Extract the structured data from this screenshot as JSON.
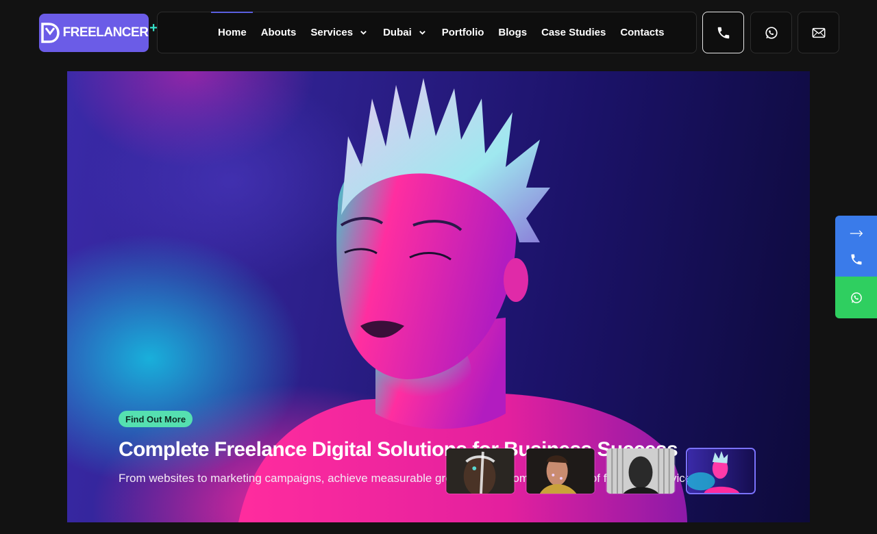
{
  "logo": {
    "text": "FREELANCER",
    "plus": "+",
    "colors": {
      "bg": "#6b5ce7",
      "accent": "#35e0c8"
    }
  },
  "nav": {
    "items": [
      {
        "label": "Home",
        "active": true
      },
      {
        "label": "Abouts"
      },
      {
        "label": "Services",
        "dropdown": true
      },
      {
        "label": "Dubai",
        "dropdown": true
      },
      {
        "label": "Portfolio"
      },
      {
        "label": "Blogs"
      },
      {
        "label": "Case Studies"
      },
      {
        "label": "Contacts"
      }
    ],
    "active_color": "#5b5fe0"
  },
  "header_actions": [
    {
      "icon": "phone-icon"
    },
    {
      "icon": "whatsapp-icon"
    },
    {
      "icon": "mail-icon"
    }
  ],
  "hero": {
    "badge": "Find Out More",
    "title": "Complete Freelance Digital Solutions for Business Success",
    "subtitle": "From websites to marketing campaigns, achieve measurable growth with a complete range of freelance services",
    "badge_color": "#55e0b0",
    "thumbnails": [
      {
        "name": "thumb-face-paint",
        "active": false
      },
      {
        "name": "thumb-glitter-portrait",
        "active": false
      },
      {
        "name": "thumb-monochrome-man",
        "active": false
      },
      {
        "name": "thumb-neon-portrait",
        "active": true
      }
    ]
  },
  "side_widget": {
    "items": [
      {
        "icon": "arrow-right-icon"
      },
      {
        "icon": "phone-icon"
      },
      {
        "icon": "whatsapp-icon"
      }
    ],
    "colors": {
      "blue": "#3a7bea",
      "green": "#2fcf60"
    }
  }
}
